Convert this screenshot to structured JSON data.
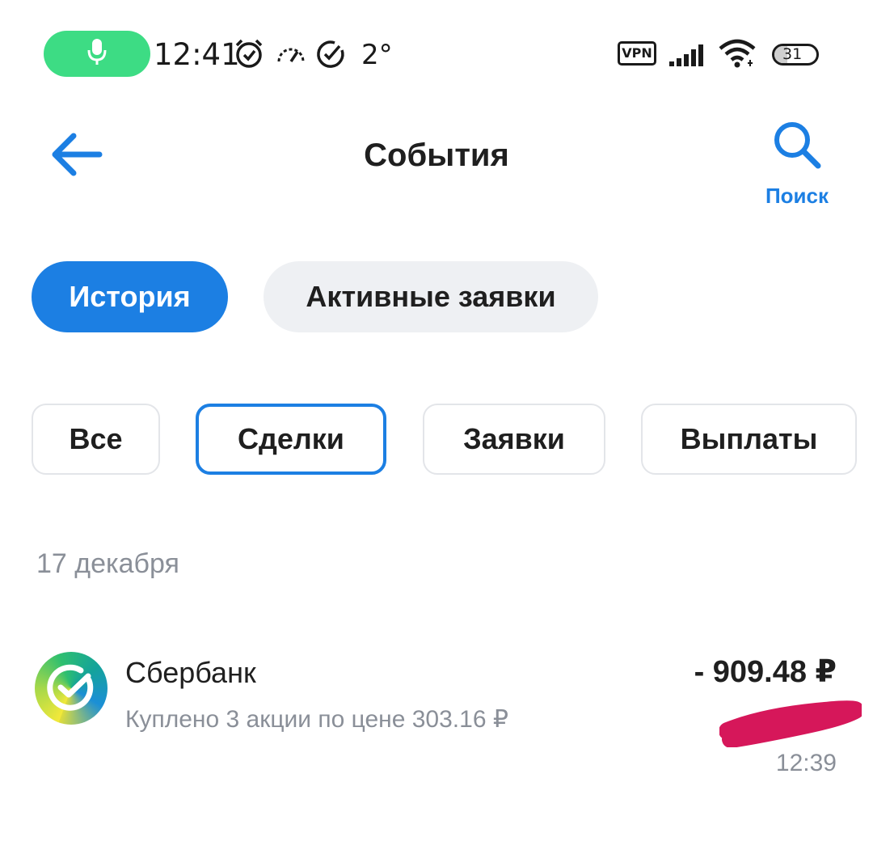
{
  "status_bar": {
    "time": "12:41",
    "temperature": "2°",
    "vpn_label": "VPN",
    "battery_level": "31",
    "battery_fraction": 0.31,
    "icons": [
      "mic-icon",
      "alarm-clock-icon",
      "speedometer-icon",
      "check-circle-icon",
      "signal-icon",
      "wifi-icon"
    ],
    "mic_color": "#3ddc84"
  },
  "header": {
    "back_icon": "arrow-left-icon",
    "title": "События",
    "search_icon": "search-icon",
    "search_label": "Поиск"
  },
  "segmented_tabs": [
    {
      "label": "История",
      "active": true
    },
    {
      "label": "Активные заявки",
      "active": false
    }
  ],
  "filter_chips": [
    {
      "label": "Все",
      "selected": false
    },
    {
      "label": "Сделки",
      "selected": true
    },
    {
      "label": "Заявки",
      "selected": false
    },
    {
      "label": "Выплаты",
      "selected": false
    }
  ],
  "events": {
    "date_header": "17 декабря",
    "items": [
      {
        "logo_icon": "sberbank-logo-icon",
        "name": "Сбербанк",
        "description": "Куплено 3 акции по цене 303.16 ₽",
        "amount": "- 909.48 ₽",
        "time": "12:39",
        "redacted": true
      }
    ]
  },
  "colors": {
    "accent": "#1c7fe3",
    "chip_border": "#e3e5e9",
    "inactive_tab_bg": "#eef0f3",
    "secondary_text": "#8a8f98",
    "redaction": "#d6175a"
  }
}
